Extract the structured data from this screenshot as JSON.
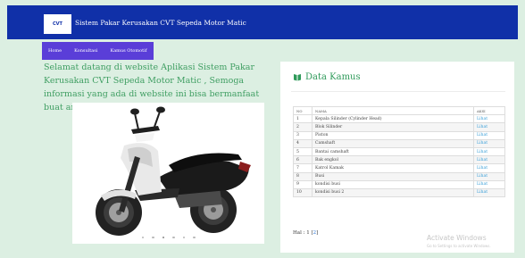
{
  "header": {
    "logo_text": "CVT",
    "title": "Sistem Pakar Kerusakan CVT Sepeda Motor Matic"
  },
  "nav": {
    "items": [
      "Home",
      "Konsultasi",
      "Kamus Otomotif"
    ]
  },
  "welcome": "Selamat datang di website Aplikasi Sistem Pakar Kerusakan CVT Sepeda Motor Matic , Semoga informasi yang ada di website ini bisa bermanfaat buat anda.",
  "carousel": {
    "image": "scooter-image",
    "slide_count": 6,
    "active_index": 2
  },
  "kamus": {
    "title": "Data Kamus",
    "icon": "book-icon",
    "columns": [
      "NO",
      "NAMA",
      "AKSI"
    ],
    "rows": [
      {
        "no": "1",
        "nama": "Kepala Silinder (Cylinder Head)",
        "aksi": "Lihat"
      },
      {
        "no": "2",
        "nama": "Blok Silinder",
        "aksi": "Lihat"
      },
      {
        "no": "3",
        "nama": "Piston",
        "aksi": "Lihat"
      },
      {
        "no": "4",
        "nama": "Camshaft",
        "aksi": "Lihat"
      },
      {
        "no": "5",
        "nama": "Bantai camshaft",
        "aksi": "Lihat"
      },
      {
        "no": "6",
        "nama": "Bak engkol",
        "aksi": "Lihat"
      },
      {
        "no": "7",
        "nama": "Katrol Kamak",
        "aksi": "Lihat"
      },
      {
        "no": "8",
        "nama": "Busi",
        "aksi": "Lihat"
      },
      {
        "no": "9",
        "nama": "kondisi busi",
        "aksi": "Lihat"
      },
      {
        "no": "10",
        "nama": "kondisi busi 2",
        "aksi": "Lihat"
      }
    ],
    "pager": {
      "label": "Hal :",
      "current": "1",
      "next": "2"
    }
  },
  "watermark": {
    "line1": "Activate Windows",
    "line2": "Go to Settings to activate Windows."
  },
  "colors": {
    "header": "#1030a8",
    "nav": "#5a3ed8",
    "text_green": "#3f9e62",
    "page_bg": "#dcefe2"
  }
}
